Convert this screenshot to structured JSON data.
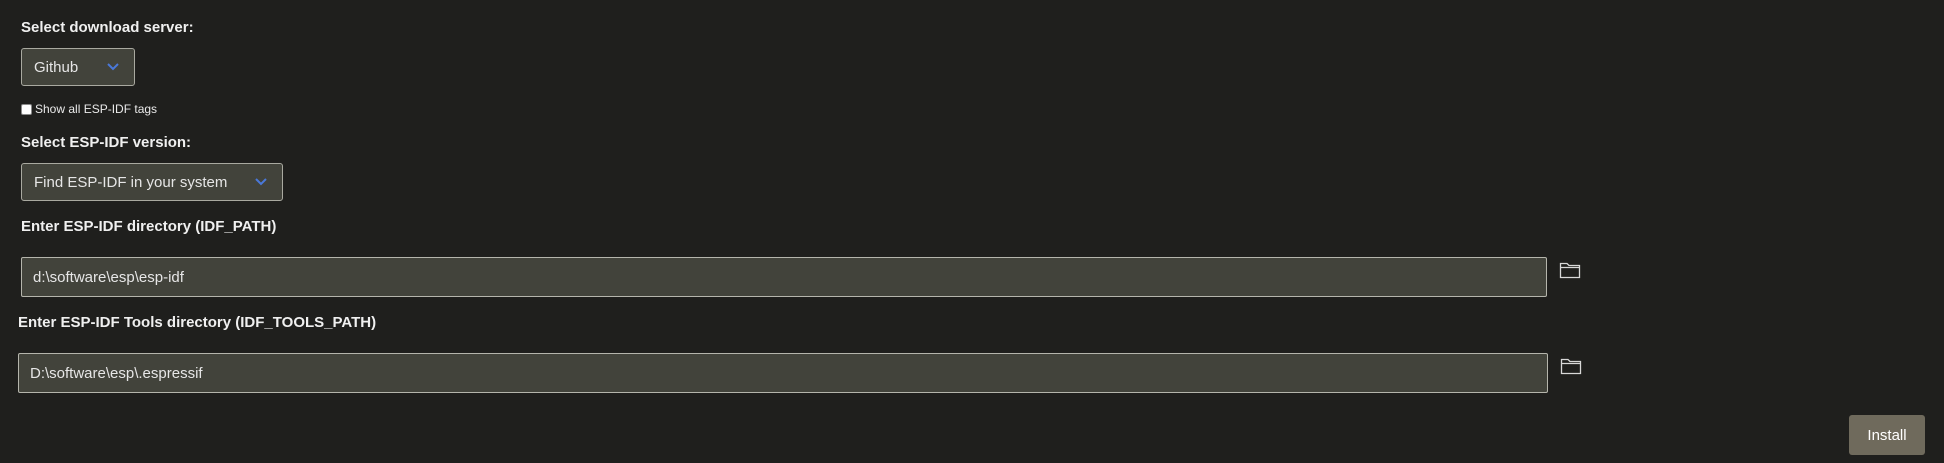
{
  "server": {
    "label": "Select download server:",
    "selected": "Github"
  },
  "tags_checkbox": {
    "label": "Show all ESP-IDF tags",
    "checked": false
  },
  "version": {
    "label": "Select ESP-IDF version:",
    "selected": "Find ESP-IDF in your system"
  },
  "idf_path": {
    "label": "Enter ESP-IDF directory (IDF_PATH)",
    "value": "d:\\software\\esp\\esp-idf"
  },
  "tools_path": {
    "label": "Enter ESP-IDF Tools directory (IDF_TOOLS_PATH)",
    "value": "D:\\software\\esp\\.espressif"
  },
  "install_button": {
    "label": "Install"
  },
  "icons": {
    "chevron": "chevron-down-icon",
    "folder": "folder-icon"
  },
  "colors": {
    "background": "#1f1f1d",
    "field": "#42433b",
    "chevron": "#4a78d9",
    "button": "#6f6a5c"
  }
}
